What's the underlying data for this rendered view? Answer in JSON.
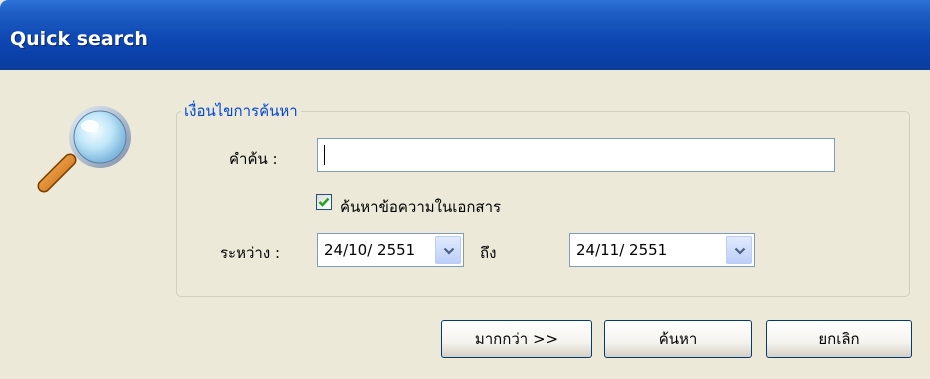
{
  "window": {
    "title": "Quick search"
  },
  "icons": {
    "app": "magnifier-icon",
    "check": "checkmark-icon",
    "dropdown": "chevron-down-icon"
  },
  "group": {
    "legend": "เงื่อนไขการค้นหา"
  },
  "keyword": {
    "label": "คำค้น :",
    "value": ""
  },
  "search_in_document": {
    "label": "ค้นหาข้อความในเอกสาร",
    "checked": true
  },
  "date_range": {
    "label": "ระหว่าง :",
    "from": "24/10/ 2551",
    "to_label": "ถึง",
    "to": "24/11/ 2551"
  },
  "buttons": {
    "more": "มากกว่า >>",
    "search": "ค้นหา",
    "cancel": "ยกเลิก"
  },
  "colors": {
    "titlebar": "#0A3FA6",
    "dialog_bg": "#ECE9D8",
    "legend_text": "#0046D5",
    "check": "#21A121"
  }
}
